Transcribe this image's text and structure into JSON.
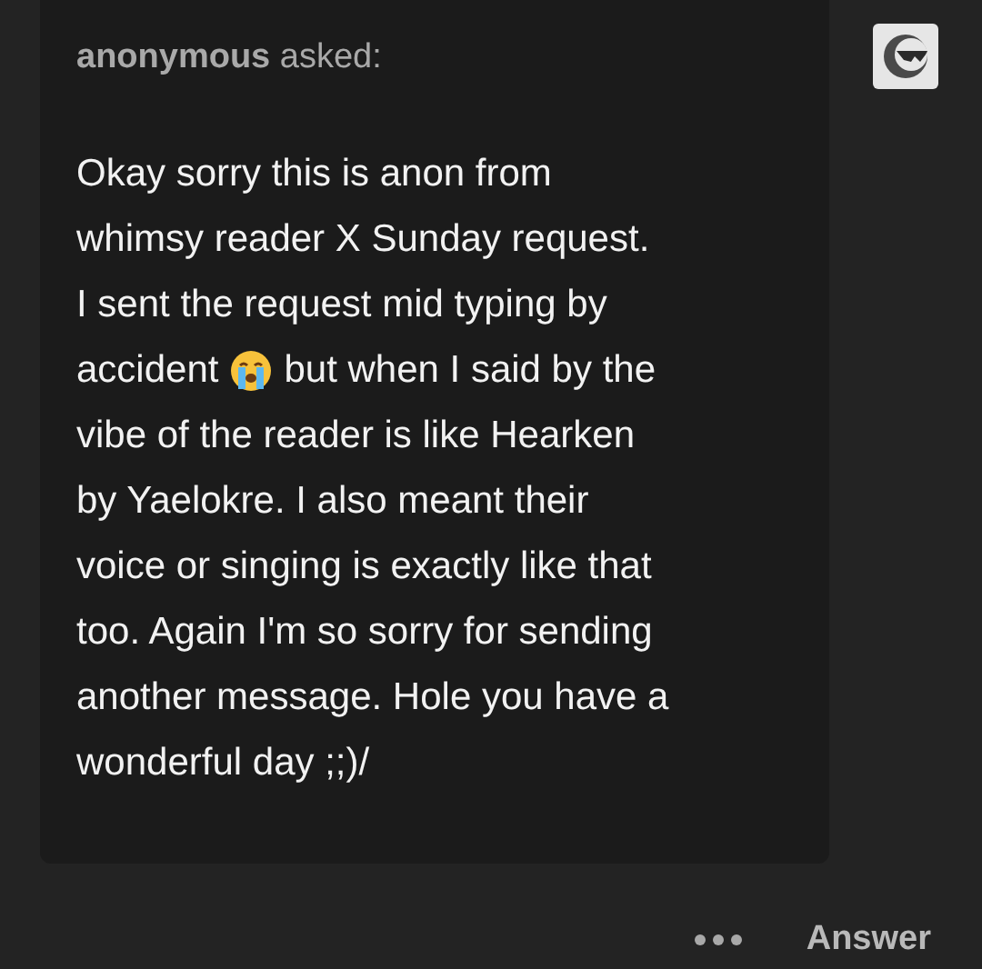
{
  "question": {
    "asker": "anonymous",
    "verb": "asked:",
    "lines": [
      {
        "segments": [
          {
            "kind": "text",
            "text": "Okay sorry this is anon from"
          }
        ]
      },
      {
        "segments": [
          {
            "kind": "text",
            "text": "whimsy reader X Sunday request."
          }
        ]
      },
      {
        "segments": [
          {
            "kind": "text",
            "text": "I sent the request mid typing by"
          }
        ]
      },
      {
        "segments": [
          {
            "kind": "text",
            "text": "accident"
          },
          {
            "kind": "crying-emoji"
          },
          {
            "kind": "text",
            "text": "but when I said by the"
          }
        ]
      },
      {
        "segments": [
          {
            "kind": "text",
            "text": "vibe of the reader is like Hearken"
          }
        ]
      },
      {
        "segments": [
          {
            "kind": "text",
            "text": "by Yaelokre. I also meant their"
          }
        ]
      },
      {
        "segments": [
          {
            "kind": "text",
            "text": "voice or singing is exactly like that"
          }
        ]
      },
      {
        "segments": [
          {
            "kind": "text",
            "text": "too. Again I'm so sorry for sending"
          }
        ]
      },
      {
        "segments": [
          {
            "kind": "text",
            "text": "another message. Hole you have a"
          }
        ]
      },
      {
        "segments": [
          {
            "kind": "text",
            "text": "wonderful day ;;)/"
          }
        ]
      }
    ]
  },
  "footer": {
    "answer": "Answer"
  }
}
